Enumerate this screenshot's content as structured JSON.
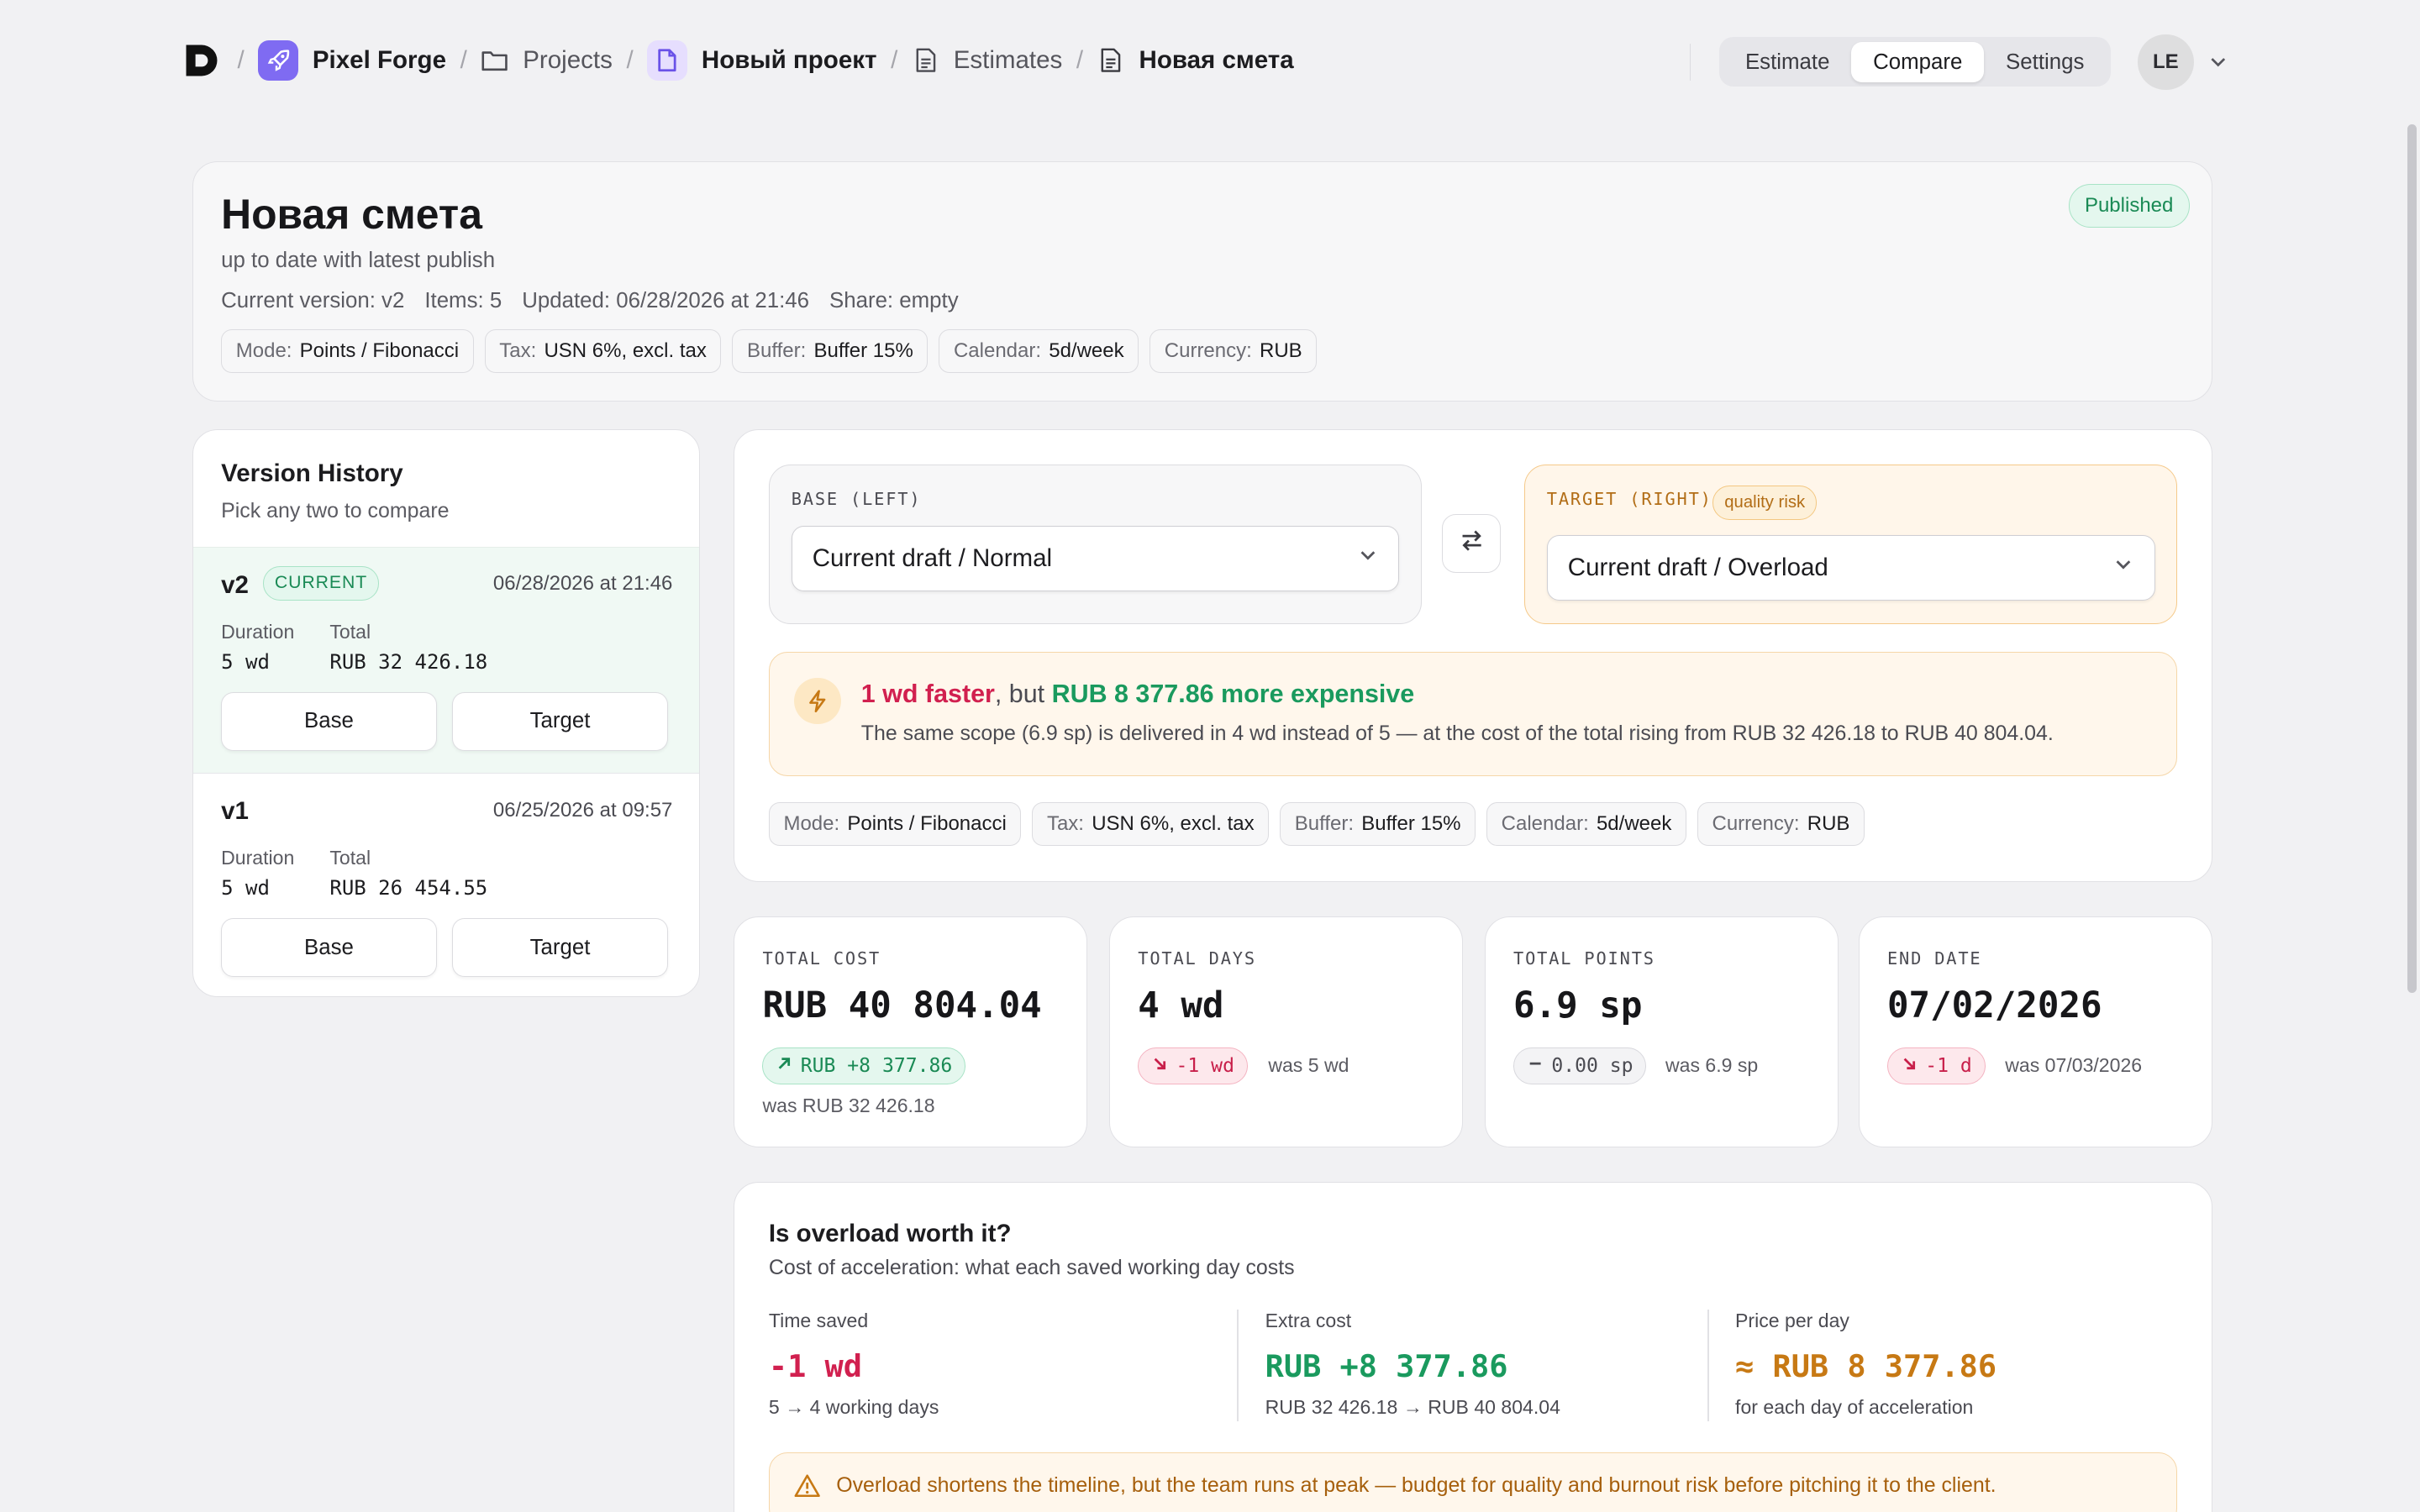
{
  "breadcrumb": {
    "workspace": "Pixel Forge",
    "projects": "Projects",
    "project": "Новый проект",
    "estimates": "Estimates",
    "estimate": "Новая смета"
  },
  "nav_tabs": [
    "Estimate",
    "Compare",
    "Settings"
  ],
  "active_tab": "Compare",
  "user": {
    "initials": "LE"
  },
  "header": {
    "title": "Новая смета",
    "subtitle": "up to date with latest publish",
    "status": "Published",
    "meta": [
      "Current version: v2",
      "Items: 5",
      "Updated: 06/28/2026 at 21:46",
      "Share: empty"
    ]
  },
  "params": [
    {
      "key": "Mode:",
      "value": "Points / Fibonacci"
    },
    {
      "key": "Tax:",
      "value": "USN 6%, excl. tax"
    },
    {
      "key": "Buffer:",
      "value": "Buffer 15%"
    },
    {
      "key": "Calendar:",
      "value": "5d/week"
    },
    {
      "key": "Currency:",
      "value": "RUB"
    }
  ],
  "version_history": {
    "title": "Version History",
    "subtitle": "Pick any two to compare",
    "duration_label": "Duration",
    "total_label": "Total",
    "base_label": "Base",
    "target_label": "Target",
    "versions": [
      {
        "name": "v2",
        "badge": "CURRENT",
        "date": "06/28/2026 at 21:46",
        "duration": "5 wd",
        "total": "RUB 32 426.18"
      },
      {
        "name": "v1",
        "date": "06/25/2026 at 09:57",
        "duration": "5 wd",
        "total": "RUB 26 454.55"
      }
    ]
  },
  "compare": {
    "base_label": "BASE (LEFT)",
    "base_value": "Current draft / Normal",
    "target_label": "TARGET (RIGHT)",
    "target_badge": "quality risk",
    "target_value": "Current draft / Overload",
    "insight": {
      "faster": "1 wd faster",
      "but": ", but ",
      "cost": "RUB 8 377.86 more expensive",
      "body": "The same scope (6.9 sp) is delivered in 4 wd instead of 5 — at the cost of the total rising from RUB 32 426.18 to RUB 40 804.04."
    }
  },
  "stats": [
    {
      "label": "TOTAL COST",
      "value": "RUB 40 804.04",
      "delta": "RUB +8 377.86",
      "delta_tone": "green",
      "was": "was RUB 32 426.18"
    },
    {
      "label": "TOTAL DAYS",
      "value": "4 wd",
      "delta": "-1 wd",
      "delta_tone": "red",
      "was": "was 5 wd"
    },
    {
      "label": "TOTAL POINTS",
      "value": "6.9 sp",
      "delta": "0.00 sp",
      "delta_tone": "grey",
      "was": "was 6.9 sp"
    },
    {
      "label": "END DATE",
      "value": "07/02/2026",
      "delta": "-1 d",
      "delta_tone": "red",
      "was": "was 07/03/2026"
    }
  ],
  "overload": {
    "title": "Is overload worth it?",
    "subtitle": "Cost of acceleration: what each saved working day costs",
    "time_saved_label": "Time saved",
    "time_saved_value": "-1 wd",
    "time_saved_foot": "5 → 4 working days",
    "extra_cost_label": "Extra cost",
    "extra_cost_value": "RUB +8 377.86",
    "extra_cost_foot": "RUB 32 426.18 → RUB 40 804.04",
    "price_label": "Price per day",
    "price_value": "≈ RUB 8 377.86",
    "price_foot": "for each day of acceleration",
    "warning": "Overload shortens the timeline, but the team runs at peak — budget for quality and burnout risk before pitching it to the client."
  },
  "colors": {
    "accent": "#7f6bf2",
    "positive": "#1a9a5e",
    "negative": "#d1204f",
    "warning": "#c77914"
  }
}
